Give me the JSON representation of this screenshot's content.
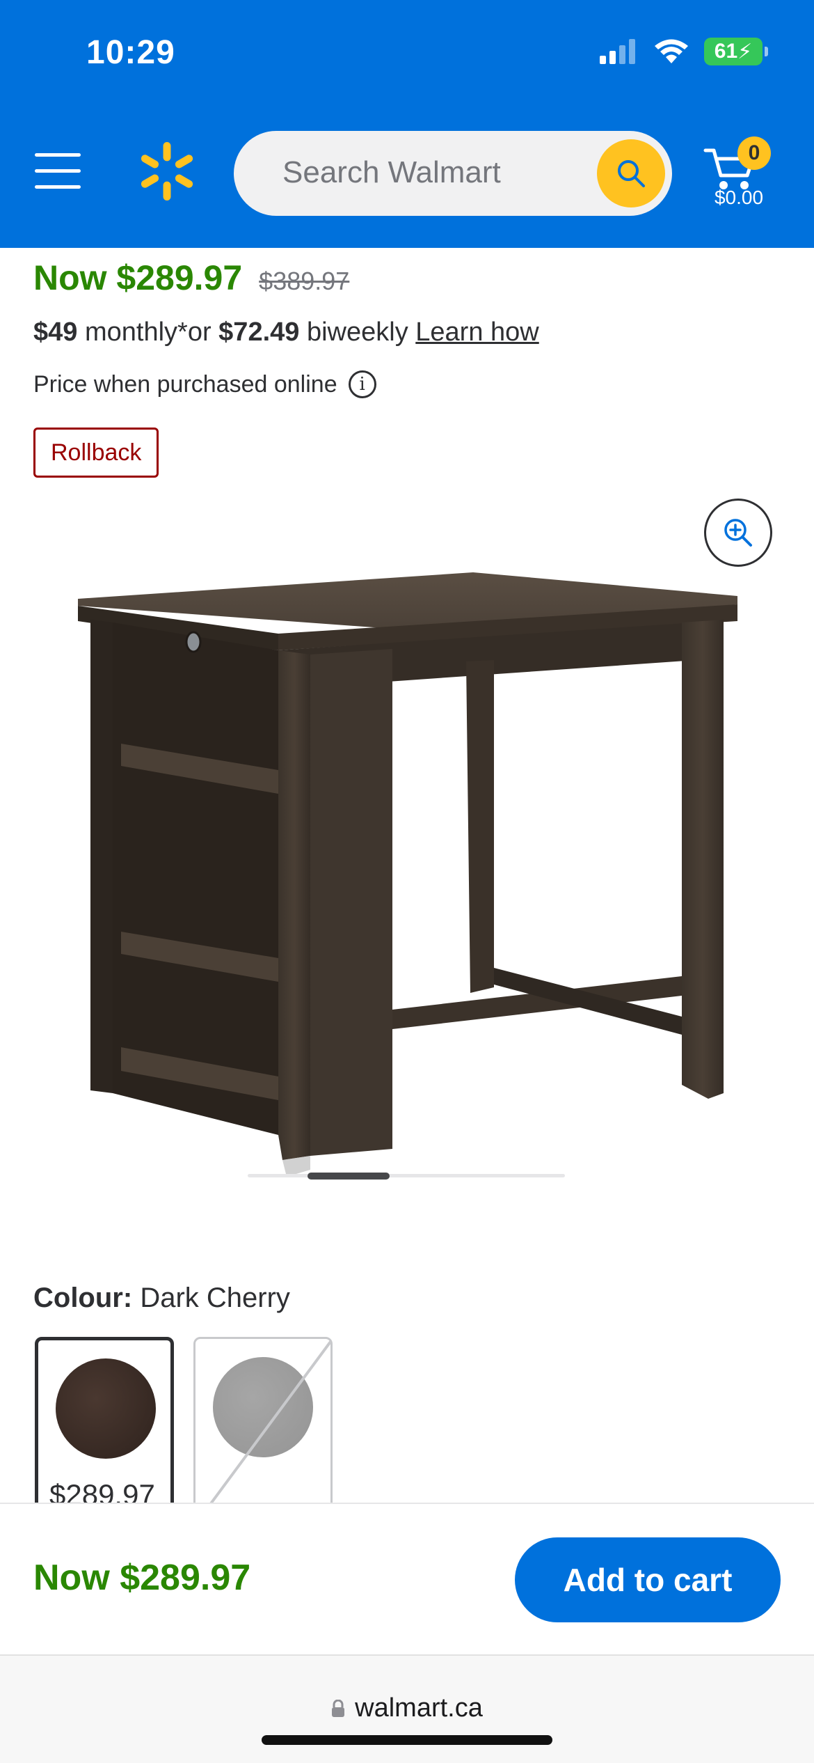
{
  "status_bar": {
    "time": "10:29",
    "battery": "61"
  },
  "header": {
    "search_placeholder": "Search Walmart",
    "cart_count": "0",
    "cart_total": "$0.00"
  },
  "product": {
    "price_now": "Now $289.97",
    "price_was": "$389.97",
    "monthly_amount": "$49",
    "monthly_text": "monthly*or",
    "biweekly_amount": "$72.49",
    "biweekly_text": "biweekly",
    "learn_how": "Learn how",
    "online_note": "Price when purchased online",
    "badge": "Rollback",
    "carousel_position": 0.3
  },
  "colour": {
    "label": "Colour:",
    "value": "Dark Cherry",
    "swatches": [
      {
        "price": "$289.97",
        "color": "#3a2a24"
      },
      {
        "price": "",
        "color": "#9d9d9d"
      }
    ]
  },
  "bottom_bar": {
    "price": "Now $289.97",
    "add_to_cart": "Add to cart"
  },
  "browser": {
    "url": "walmart.ca"
  }
}
